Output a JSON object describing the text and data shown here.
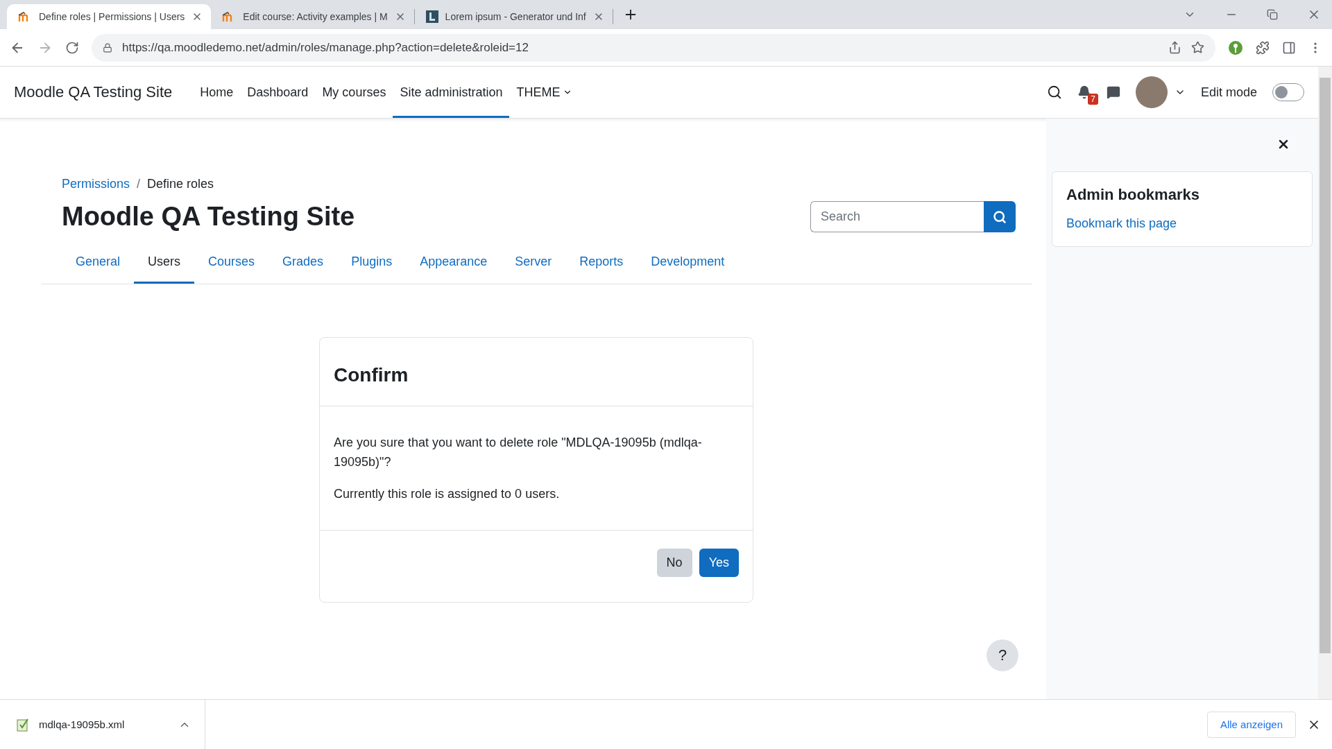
{
  "browser": {
    "tabs": [
      {
        "title": "Define roles | Permissions | Users",
        "kind": "moodle",
        "selected": true
      },
      {
        "title": "Edit course: Activity examples | M",
        "kind": "moodle",
        "selected": false
      },
      {
        "title": "Lorem ipsum - Generator und Inf",
        "kind": "lorem",
        "selected": false
      }
    ],
    "url": "https://qa.moodledemo.net/admin/roles/manage.php?action=delete&roleid=12"
  },
  "navbar": {
    "site_name": "Moodle QA Testing Site",
    "items": [
      {
        "label": "Home",
        "selected": false,
        "dropdown": false
      },
      {
        "label": "Dashboard",
        "selected": false,
        "dropdown": false
      },
      {
        "label": "My courses",
        "selected": false,
        "dropdown": false
      },
      {
        "label": "Site administration",
        "selected": true,
        "dropdown": false
      },
      {
        "label": "THEME",
        "selected": false,
        "dropdown": true
      }
    ],
    "notification_count": "7",
    "edit_mode": {
      "label": "Edit mode",
      "on": false
    }
  },
  "breadcrumb": {
    "separator": "/",
    "items": [
      {
        "label": "Permissions",
        "link": true
      },
      {
        "label": "Define roles",
        "link": false
      }
    ]
  },
  "heading": "Moodle QA Testing Site",
  "search": {
    "placeholder": "Search"
  },
  "admin_tabs": [
    {
      "label": "General",
      "selected": false
    },
    {
      "label": "Users",
      "selected": true
    },
    {
      "label": "Courses",
      "selected": false
    },
    {
      "label": "Grades",
      "selected": false
    },
    {
      "label": "Plugins",
      "selected": false
    },
    {
      "label": "Appearance",
      "selected": false
    },
    {
      "label": "Server",
      "selected": false
    },
    {
      "label": "Reports",
      "selected": false
    },
    {
      "label": "Development",
      "selected": false
    }
  ],
  "dialog": {
    "title": "Confirm",
    "message": "Are you sure that you want to delete role \"MDLQA-19095b (mdlqa-19095b)\"?",
    "note": "Currently this role is assigned to 0 users.",
    "buttons": [
      {
        "label": "No",
        "kind": "secondary"
      },
      {
        "label": "Yes",
        "kind": "primary"
      }
    ]
  },
  "help_button": "?",
  "drawer": {
    "title": "Admin bookmarks",
    "link": "Bookmark this page"
  },
  "download_bar": {
    "filename": "mdlqa-19095b.xml",
    "show_all": "Alle anzeigen"
  }
}
